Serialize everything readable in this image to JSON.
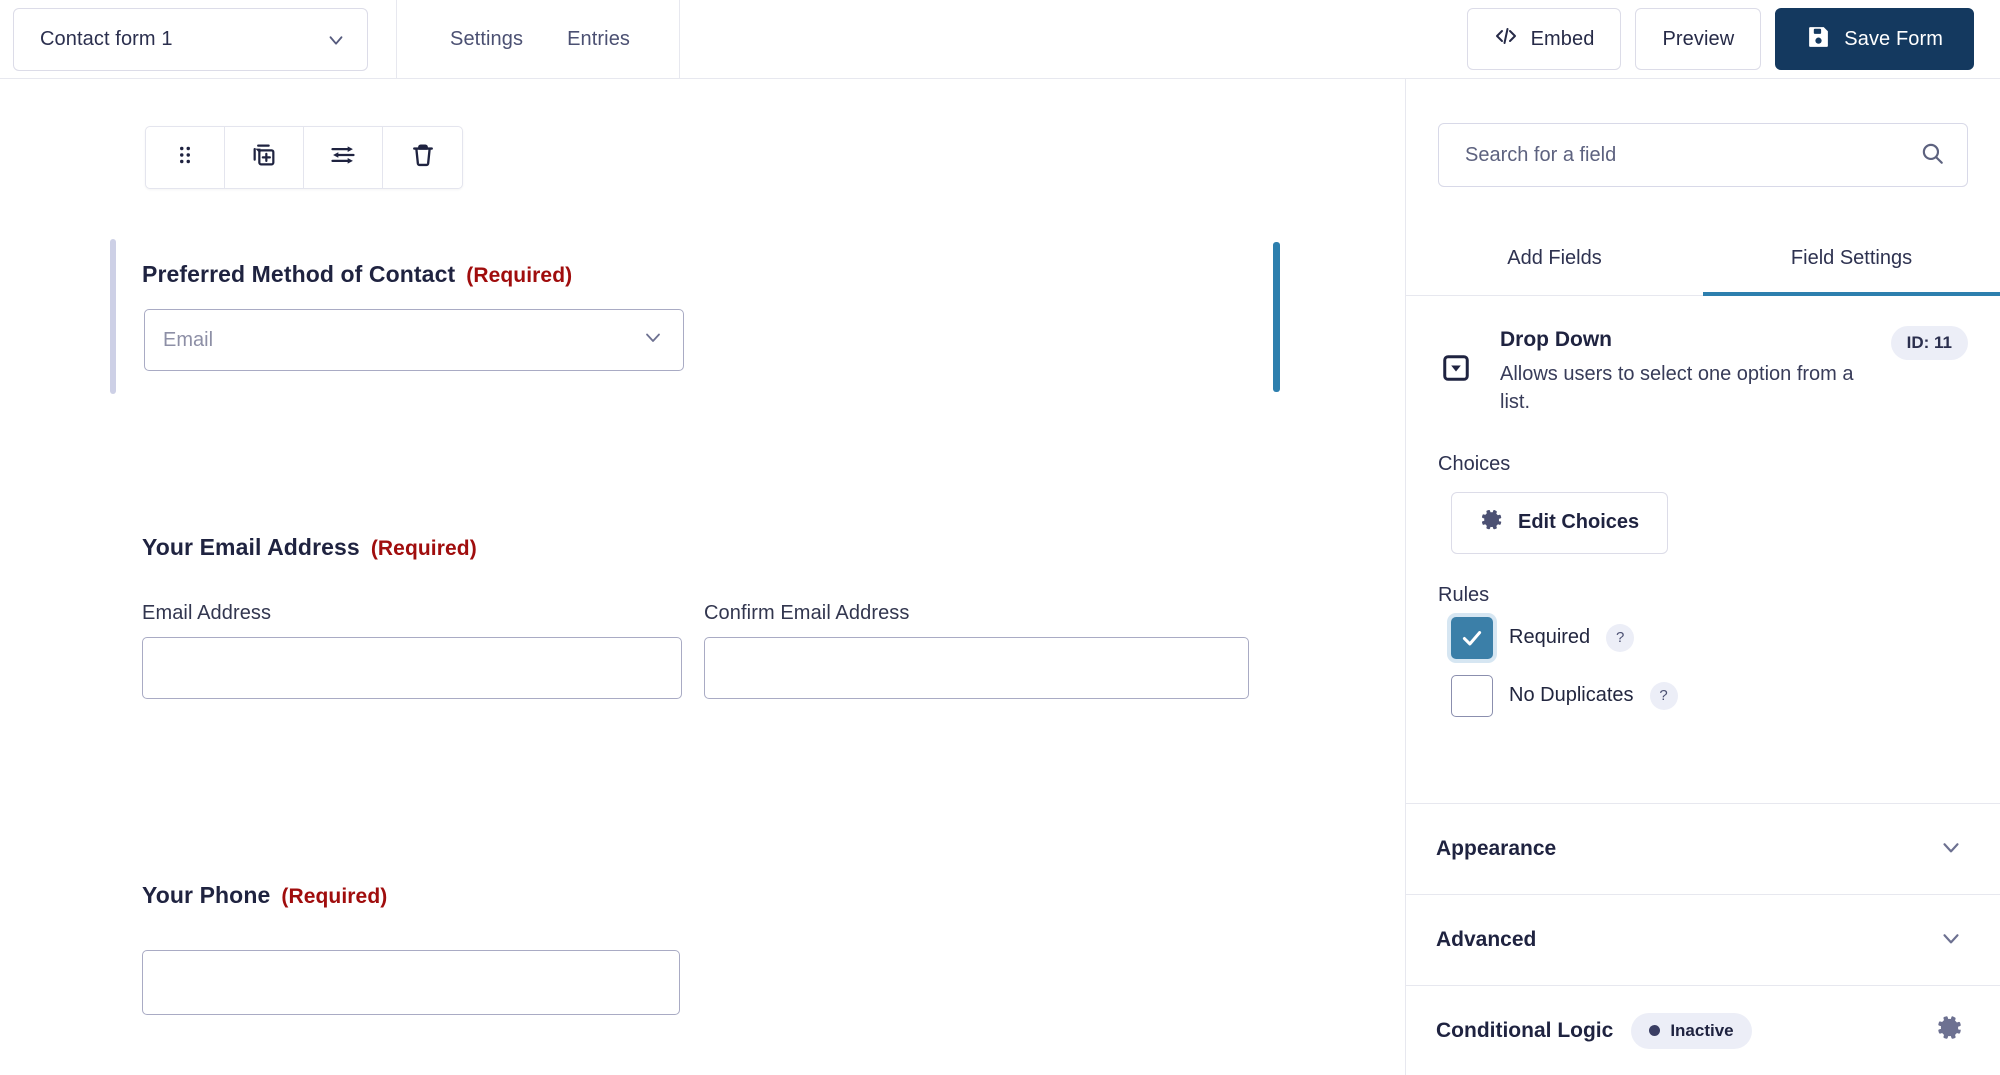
{
  "header": {
    "form_selector": {
      "value": "Contact form 1",
      "icon": "chevron-down-icon"
    },
    "nav_tabs": [
      {
        "label": "Settings"
      },
      {
        "label": "Entries"
      }
    ],
    "actions": {
      "embed_label": "Embed",
      "embed_icon": "code-brackets-icon",
      "preview_label": "Preview",
      "save_label": "Save Form",
      "save_icon": "floppy-disk-icon",
      "save_bg": "#14395f"
    }
  },
  "canvas": {
    "field_toolbar": [
      {
        "name": "drag-handle-icon",
        "title": "Move"
      },
      {
        "name": "duplicate-icon",
        "title": "Duplicate"
      },
      {
        "name": "sliders-icon",
        "title": "Settings"
      },
      {
        "name": "trash-icon",
        "title": "Delete"
      }
    ],
    "selection_colors": {
      "left_bar": "#cdd0e6",
      "right_bar": "#2d7fae"
    },
    "fields": [
      {
        "label": "Preferred Method of Contact",
        "required_text": "(Required)",
        "type": "select",
        "placeholder": "Email",
        "selected": true
      },
      {
        "label": "Your Email Address",
        "required_text": "(Required)",
        "type": "email-confirm",
        "sub_fields": [
          {
            "label": "Email Address",
            "value": ""
          },
          {
            "label": "Confirm Email Address",
            "value": ""
          }
        ]
      },
      {
        "label": "Your Phone",
        "required_text": "(Required)",
        "type": "text",
        "value": ""
      }
    ]
  },
  "sidebar": {
    "search": {
      "placeholder": "Search for a field",
      "value": "",
      "icon": "search-icon"
    },
    "tabs": [
      {
        "label": "Add Fields",
        "active": false
      },
      {
        "label": "Field Settings",
        "active": true
      }
    ],
    "active_tab_color": "#2d7fae",
    "field_info": {
      "icon": "dropdown-box-icon",
      "title": "Drop Down",
      "description": "Allows users to select one option from a list.",
      "id_badge": "ID: 11"
    },
    "choices": {
      "section_label": "Choices",
      "edit_button_label": "Edit Choices",
      "edit_button_icon": "gear-icon"
    },
    "rules": {
      "section_label": "Rules",
      "items": [
        {
          "label": "Required",
          "checked": true,
          "help": "?"
        },
        {
          "label": "No Duplicates",
          "checked": false,
          "help": "?"
        }
      ],
      "checked_color": "#3b7fa8"
    },
    "accordions": [
      {
        "title": "Appearance",
        "icon": "chevron-down-icon"
      },
      {
        "title": "Advanced",
        "icon": "chevron-down-icon"
      }
    ],
    "conditional_logic": {
      "title": "Conditional Logic",
      "status": "Inactive",
      "gear_icon": "gear-icon"
    }
  }
}
